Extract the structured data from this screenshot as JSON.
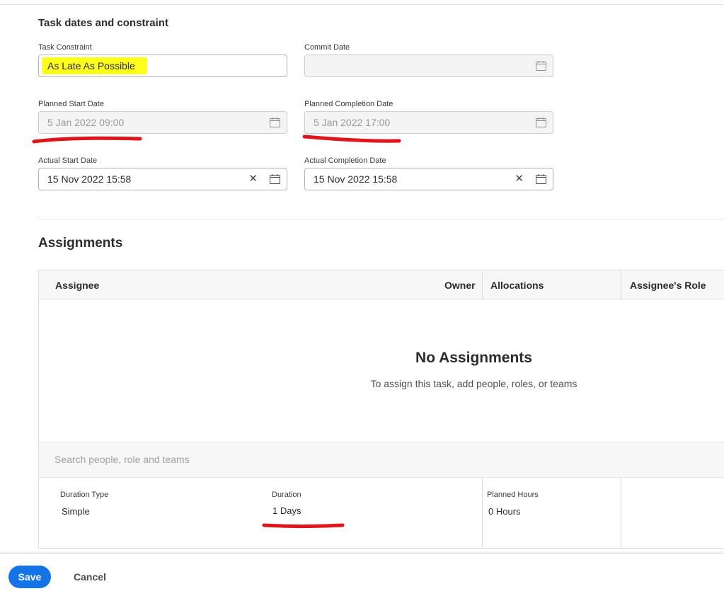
{
  "task_dates": {
    "title": "Task dates and constraint",
    "task_constraint": {
      "label": "Task Constraint",
      "value": "As Late As Possible"
    },
    "commit_date": {
      "label": "Commit Date",
      "value": ""
    },
    "planned_start": {
      "label": "Planned Start Date",
      "value": "5 Jan 2022 09:00"
    },
    "planned_completion": {
      "label": "Planned Completion Date",
      "value": "5 Jan 2022 17:00"
    },
    "actual_start": {
      "label": "Actual Start Date",
      "value": "15 Nov 2022 15:58"
    },
    "actual_completion": {
      "label": "Actual Completion Date",
      "value": "15 Nov 2022 15:58"
    }
  },
  "assignments": {
    "title": "Assignments",
    "columns": [
      "Assignee",
      "Owner",
      "Allocations",
      "Assignee's Role"
    ],
    "empty_title": "No Assignments",
    "empty_subtitle": "To assign this task, add people, roles, or teams",
    "search_placeholder": "Search people, role and teams",
    "duration_type": {
      "label": "Duration Type",
      "value": "Simple"
    },
    "duration": {
      "label": "Duration",
      "value": "1 Days"
    },
    "planned_hours": {
      "label": "Planned Hours",
      "value": "0 Hours"
    }
  },
  "footer": {
    "save_label": "Save",
    "cancel_label": "Cancel"
  },
  "icons": {
    "calendar": "calendar-icon",
    "clear": "close-icon"
  },
  "colors": {
    "accent": "#1473e6",
    "highlight": "#ffff1a",
    "annotation_red": "#e0151b"
  }
}
